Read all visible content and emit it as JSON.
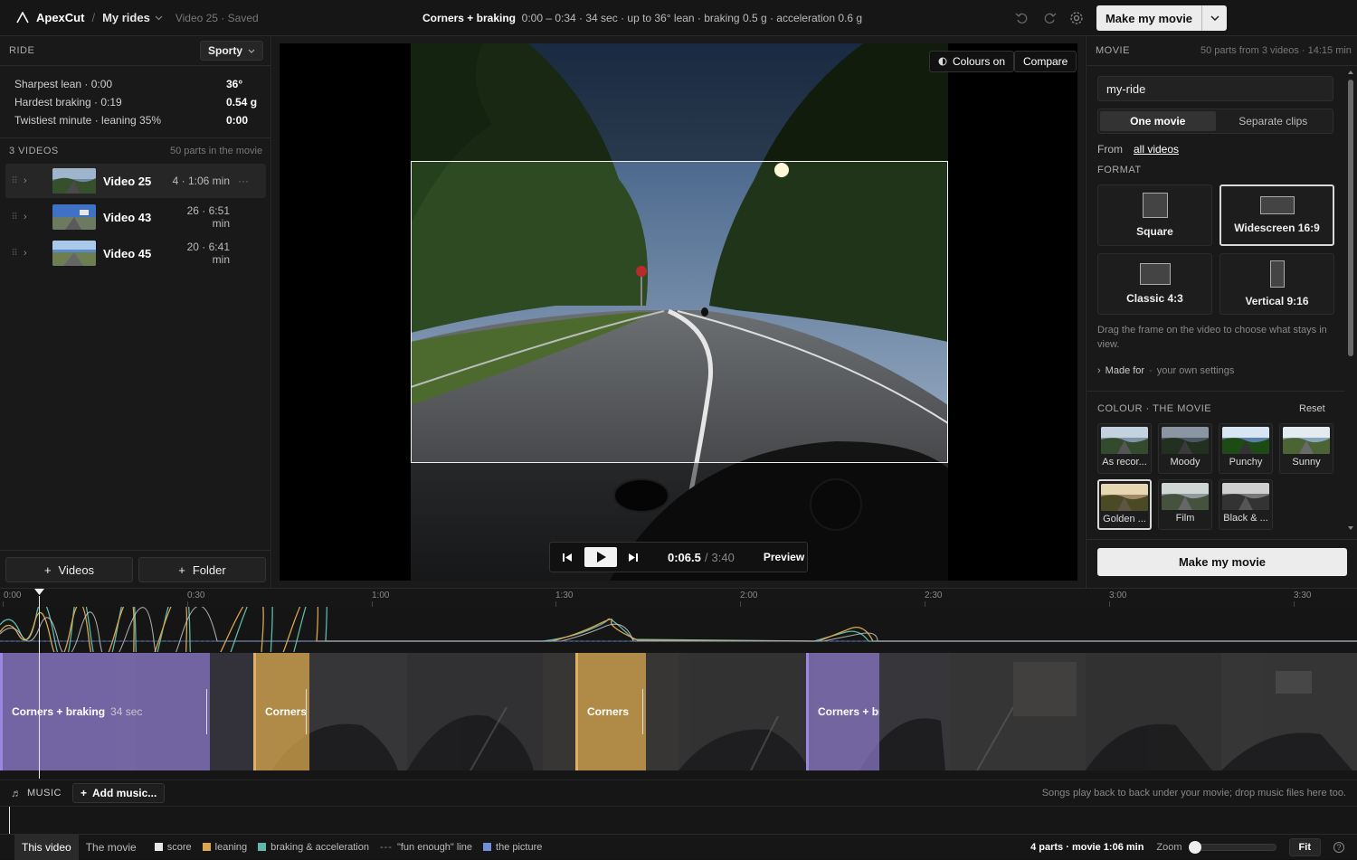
{
  "app": {
    "name": "ApexCut",
    "breadcrumb": "My rides",
    "status": "Video 25 · Saved"
  },
  "header": {
    "title_bold": "Corners + braking",
    "title_rest": "0:00 – 0:34 · 34 sec · up to 36° lean · braking 0.5 g · acceleration 0.6 g",
    "make_label": "Make my movie"
  },
  "ride": {
    "label": "RIDE",
    "style": "Sporty",
    "highlights": [
      {
        "k": "Sharpest lean · 0:00",
        "v": "36°"
      },
      {
        "k": "Hardest braking · 0:19",
        "v": "0.54 g"
      },
      {
        "k": "Twistiest minute · leaning 35%",
        "v": "0:00"
      }
    ]
  },
  "videos": {
    "label": "3 VIDEOS",
    "note": "50 parts in the movie",
    "items": [
      {
        "name": "Video 25",
        "meta": "4 · 1:06 min",
        "more": "···"
      },
      {
        "name": "Video 43",
        "meta": "26 · 6:51 min",
        "more": ""
      },
      {
        "name": "Video 45",
        "meta": "20 · 6:41 min",
        "more": ""
      }
    ],
    "add_videos": "Videos",
    "add_folder": "Folder"
  },
  "preview": {
    "colours_label": "Colours on",
    "compare_label": "Compare",
    "time_current": "0:06.5",
    "time_sep": "/",
    "time_total": "3:40",
    "preview_label": "Preview"
  },
  "movie": {
    "label": "MOVIE",
    "note": "50 parts from 3 videos · 14:15 min",
    "name": "my-ride",
    "mode_one": "One movie",
    "mode_separate": "Separate clips",
    "from_label": "From",
    "from_value": "all videos",
    "format_label": "FORMAT",
    "formats": [
      "Square",
      "Widescreen 16:9",
      "Classic 4:3",
      "Vertical 9:16"
    ],
    "hint": "Drag the frame on the video to choose what stays in view.",
    "made_for_label": "Made for",
    "made_for_value": "your own settings",
    "colour_label": "COLOUR · THE MOVIE",
    "reset_label": "Reset",
    "looks": [
      "As recor...",
      "Moody",
      "Punchy",
      "Sunny",
      "Golden ...",
      "Film",
      "Black & ..."
    ],
    "make_label": "Make my movie"
  },
  "timeline": {
    "ticks": [
      "0:00",
      "0:30",
      "1:00",
      "1:30",
      "2:00",
      "2:30",
      "3:00",
      "3:30"
    ],
    "segments": [
      {
        "label": "Corners + braking",
        "dur": "34 sec"
      },
      {
        "label": "Corners",
        "dur": ""
      },
      {
        "label": "Corners",
        "dur": ""
      },
      {
        "label": "Corners + br",
        "dur": ""
      }
    ],
    "music_label": "MUSIC",
    "add_music": "Add music...",
    "music_hint": "Songs play back to back under your movie; drop music files here too."
  },
  "footer": {
    "tab_video": "This video",
    "tab_movie": "The movie",
    "legend": [
      {
        "label": "score",
        "color": "#e8e8e8"
      },
      {
        "label": "leaning",
        "color": "#d9a84e"
      },
      {
        "label": "braking & acceleration",
        "color": "#5fb8a8"
      },
      {
        "label": "\"fun enough\" line",
        "color": "#888888"
      },
      {
        "label": "the picture",
        "color": "#6f8fd8"
      }
    ],
    "summary": "4 parts · movie 1:06 min",
    "zoom_label": "Zoom",
    "fit_label": "Fit"
  },
  "colors": {
    "accent_purple": "#8a78c8",
    "accent_orange": "#d9a84e"
  }
}
